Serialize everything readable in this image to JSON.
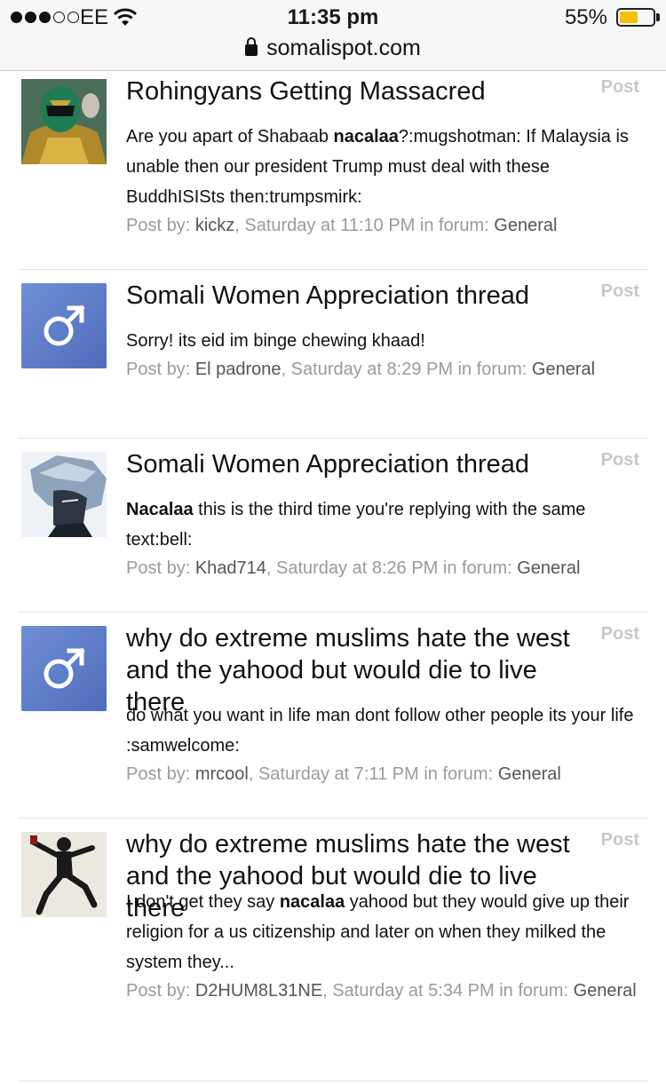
{
  "status_bar": {
    "carrier": "EE",
    "signal_bars_filled": 3,
    "signal_bars_total": 5,
    "time": "11:35 pm",
    "battery_percent": "55%",
    "battery_level": 0.55,
    "battery_color": "#f5c000"
  },
  "browser": {
    "url": "somalispot.com",
    "lock_icon": "lock-icon"
  },
  "posts": [
    {
      "title": "Rohingyans Getting Massacred",
      "label": "Post",
      "avatar": "power-ranger-avatar",
      "snippet_1": "Are you apart of Shabaab ",
      "snippet_bold": "nacalaa",
      "snippet_2": "?:mugshotman: If Malaysia is unable then our president Trump must deal with these BuddhISISts then:trumpsmirk:",
      "meta_prefix": "Post by: ",
      "author": "kickz",
      "meta_mid": ", Saturday at 11:10 PM in forum: ",
      "forum": "General"
    },
    {
      "title": "Somali Women Appreciation thread",
      "label": "Post",
      "avatar": "male-symbol-avatar",
      "snippet_1": "Sorry! its eid im binge chewing khaad!",
      "snippet_bold": "",
      "snippet_2": "",
      "meta_prefix": "Post by: ",
      "author": "El padrone",
      "meta_mid": ", Saturday at 8:29 PM in forum: ",
      "forum": "General"
    },
    {
      "title": "Somali Women Appreciation thread",
      "label": "Post",
      "avatar": "anime-character-avatar",
      "snippet_1": "",
      "snippet_bold": "Nacalaa",
      "snippet_2": " this is the third time you're replying with the same text:bell:",
      "meta_prefix": "Post by: ",
      "author": "Khad714",
      "meta_mid": ", Saturday at 8:26 PM in forum: ",
      "forum": "General"
    },
    {
      "title": "why do extreme muslims hate the west and the yahood but would die to live there",
      "label": "Post",
      "avatar": "male-symbol-avatar",
      "snippet_1": "do what you want in life man dont follow other people its your life :samwelcome:",
      "snippet_bold": "",
      "snippet_2": "",
      "meta_prefix": "Post by: ",
      "author": "mrcool",
      "meta_mid": ", Saturday at 7:11 PM in forum: ",
      "forum": "General"
    },
    {
      "title": "why do extreme muslims hate the west and the yahood but would die to live there",
      "label": "Post",
      "avatar": "jumping-figure-avatar",
      "snippet_1": "I don't get they say ",
      "snippet_bold": "nacalaa",
      "snippet_2": " yahood but they would give up their religion for a us citizenship and later on when they milked the system they...",
      "meta_prefix": "Post by: ",
      "author": "D2HUM8L31NE",
      "meta_mid": ", Saturday at 5:34 PM in forum: ",
      "forum": "General"
    }
  ]
}
